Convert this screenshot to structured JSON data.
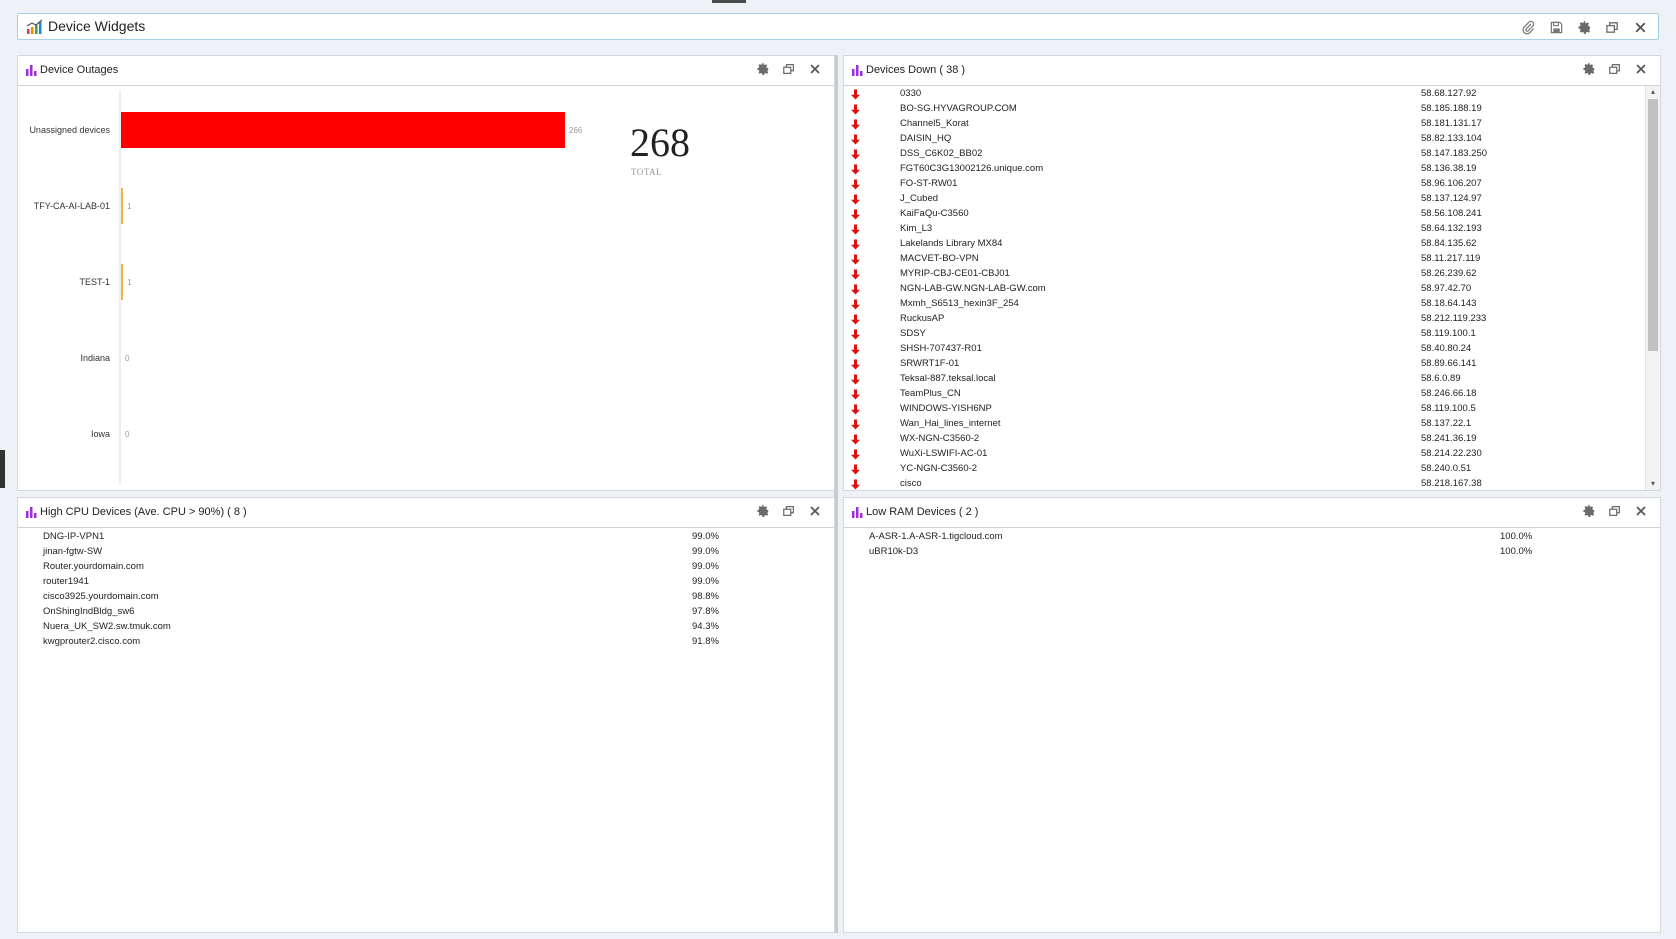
{
  "window": {
    "title": "Device Widgets"
  },
  "icons": {
    "app": "chart-growth-icon",
    "attach": "paperclip-icon",
    "save": "floppy-icon",
    "settings": "gear-icon",
    "restore": "restore-window-icon",
    "close": "close-icon",
    "panel": "bar-chart-icon",
    "status_down": "down-arrow-icon"
  },
  "colors": {
    "accent": "#9b30d9",
    "bar_primary": "#ff0000",
    "bar_secondary": "#f5b342",
    "down_arrow": "#dd1111"
  },
  "device_outages": {
    "title": "Device Outages",
    "total": "268",
    "total_label": "TOTAL",
    "chart_data": {
      "type": "bar",
      "orientation": "horizontal",
      "categories": [
        "Unassigned devices",
        "TFY-CA-AI-LAB-01",
        "TEST-1",
        "Indiana",
        "Iowa"
      ],
      "values": [
        266,
        1,
        1,
        0,
        0
      ],
      "value_labels": [
        "266",
        "1",
        "1",
        "0",
        "0"
      ],
      "xlim": [
        0,
        266
      ]
    }
  },
  "devices_down": {
    "title": "Devices Down ( 38 )",
    "rows": [
      {
        "name": "0330",
        "ip": "58.68.127.92"
      },
      {
        "name": "BO-SG.HYVAGROUP.COM",
        "ip": "58.185.188.19"
      },
      {
        "name": "Channel5_Korat",
        "ip": "58.181.131.17"
      },
      {
        "name": "DAISIN_HQ",
        "ip": "58.82.133.104"
      },
      {
        "name": "DSS_C6K02_BB02",
        "ip": "58.147.183.250"
      },
      {
        "name": "FGT60C3G13002126.unique.com",
        "ip": "58.136.38.19"
      },
      {
        "name": "FO-ST-RW01",
        "ip": "58.96.106.207"
      },
      {
        "name": "J_Cubed",
        "ip": "58.137.124.97"
      },
      {
        "name": "KaiFaQu-C3560",
        "ip": "58.56.108.241"
      },
      {
        "name": "Kim_L3",
        "ip": "58.64.132.193"
      },
      {
        "name": "Lakelands Library MX84",
        "ip": "58.84.135.62"
      },
      {
        "name": "MACVET-BO-VPN",
        "ip": "58.11.217.119"
      },
      {
        "name": "MYRIP-CBJ-CE01-CBJ01",
        "ip": "58.26.239.62"
      },
      {
        "name": "NGN-LAB-GW.NGN-LAB-GW.com",
        "ip": "58.97.42.70"
      },
      {
        "name": "Mxmh_S6513_hexin3F_254",
        "ip": "58.18.64.143"
      },
      {
        "name": "RuckusAP",
        "ip": "58.212.119.233"
      },
      {
        "name": "SDSY",
        "ip": "58.119.100.1"
      },
      {
        "name": "SHSH-707437-R01",
        "ip": "58.40.80.24"
      },
      {
        "name": "SRWRT1F-01",
        "ip": "58.89.66.141"
      },
      {
        "name": "Teksal-887.teksal.local",
        "ip": "58.6.0.89"
      },
      {
        "name": "TeamPlus_CN",
        "ip": "58.246.66.18"
      },
      {
        "name": "WINDOWS-YISH6NP",
        "ip": "58.119.100.5"
      },
      {
        "name": "Wan_Hai_lines_internet",
        "ip": "58.137.22.1"
      },
      {
        "name": "WX-NGN-C3560-2",
        "ip": "58.241.36.19"
      },
      {
        "name": "WuXi-LSWIFI-AC-01",
        "ip": "58.214.22.230"
      },
      {
        "name": "YC-NGN-C3560-2",
        "ip": "58.240.0.51"
      },
      {
        "name": "cisco",
        "ip": "58.218.167.38"
      }
    ]
  },
  "high_cpu": {
    "title": "High CPU Devices (Ave. CPU > 90%) ( 8 )",
    "rows": [
      {
        "name": "DNG-IP-VPN1",
        "value": "99.0%"
      },
      {
        "name": "jinan-fgtw-SW",
        "value": "99.0%"
      },
      {
        "name": "Router.yourdomain.com",
        "value": "99.0%"
      },
      {
        "name": "router1941",
        "value": "99.0%"
      },
      {
        "name": "cisco3925.yourdomain.com",
        "value": "98.8%"
      },
      {
        "name": "OnShingIndBldg_sw6",
        "value": "97.8%"
      },
      {
        "name": "Nuera_UK_SW2.sw.tmuk.com",
        "value": "94.3%"
      },
      {
        "name": "kwgprouter2.cisco.com",
        "value": "91.8%"
      }
    ]
  },
  "low_ram": {
    "title": "Low RAM Devices ( 2 )",
    "rows": [
      {
        "name": "A-ASR-1.A-ASR-1.tigcloud.com",
        "value": "100.0%"
      },
      {
        "name": "uBR10k-D3",
        "value": "100.0%"
      }
    ]
  }
}
